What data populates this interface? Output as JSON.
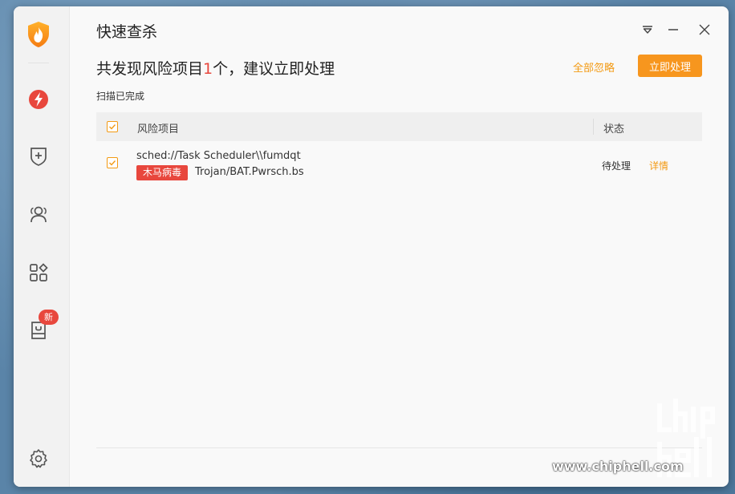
{
  "window": {
    "title": "快速查杀"
  },
  "sidebar": {
    "items": [
      {
        "name": "logo",
        "icon": "flame-shield-icon"
      },
      {
        "name": "quick-scan",
        "icon": "lightning-icon"
      },
      {
        "name": "protection",
        "icon": "shield-plus-icon"
      },
      {
        "name": "users",
        "icon": "users-icon"
      },
      {
        "name": "apps",
        "icon": "apps-grid-icon"
      },
      {
        "name": "book",
        "icon": "book-icon",
        "badge": "新"
      },
      {
        "name": "settings",
        "icon": "gear-icon"
      }
    ]
  },
  "header": {
    "headline_prefix": "共发现风险项目",
    "headline_count": "1",
    "headline_suffix": "个，建议立即处理",
    "ignore_all": "全部忽略",
    "handle_now": "立即处理",
    "scan_status": "扫描已完成"
  },
  "table": {
    "columns": [
      "风险项目",
      "状态"
    ],
    "rows": [
      {
        "path": "sched://Task Scheduler\\\\fumdqt",
        "tag": "木马病毒",
        "virus": "Trojan/BAT.Pwrsch.bs",
        "status": "待处理",
        "detail": "详情"
      }
    ]
  },
  "watermark": {
    "text": "www.chiphell.com",
    "logo": "chip hell"
  },
  "colors": {
    "accent": "#f7961e",
    "danger": "#e8473d",
    "link": "#f39a13"
  }
}
